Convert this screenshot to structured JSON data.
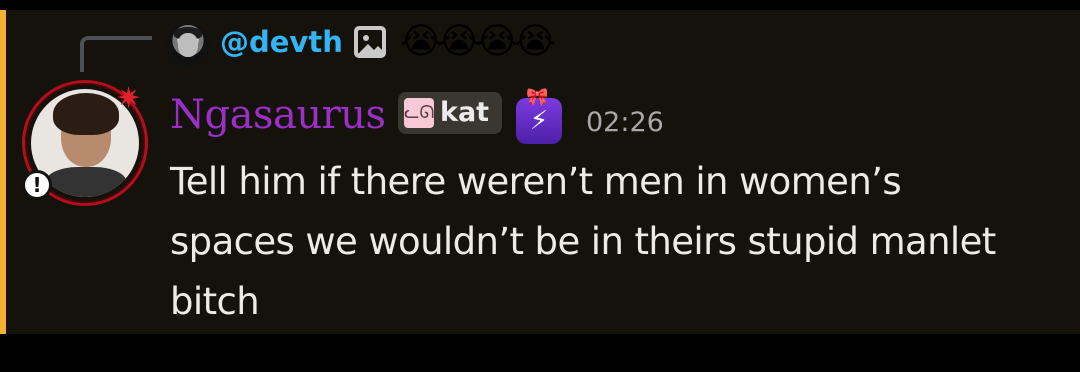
{
  "reply": {
    "username": "@devth",
    "attachment_icon": "image-icon",
    "emojis": "😭😭😭😭"
  },
  "author": {
    "name": "Ngasaurus",
    "name_color": "#9b30c9",
    "tag": {
      "icon": "cat-face-icon",
      "label": "kat"
    },
    "role_icon": "lightning-bolt-icon",
    "timestamp": "02:26",
    "avatar_decoration": "anger-symbol-icon",
    "status_badge": "!"
  },
  "message": {
    "lines": [
      "Tell him if there weren’t men in women’s",
      "spaces we wouldn’t be in theirs stupid manlet",
      "bitch"
    ]
  },
  "colors": {
    "mention_highlight_bg": "#15110b",
    "mention_accent": "#f0b232",
    "reply_username": "#33b4f5"
  }
}
